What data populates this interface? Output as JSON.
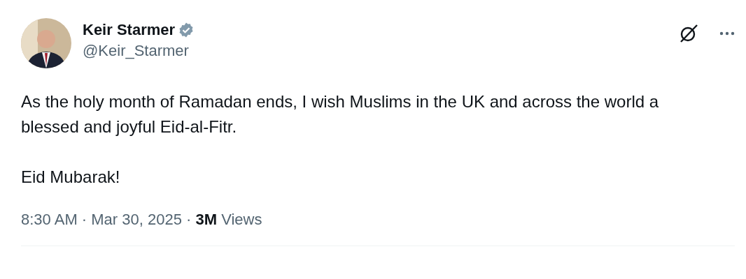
{
  "author": {
    "name": "Keir Starmer",
    "verified": true,
    "handle": "@Keir_Starmer"
  },
  "body": [
    "As the holy month of Ramadan ends, I wish Muslims in the UK and across the world a blessed and joyful Eid-al-Fitr.",
    "Eid Mubarak!"
  ],
  "meta": "8:30 AM · Mar 30, 2025 · **3M** Views"
}
